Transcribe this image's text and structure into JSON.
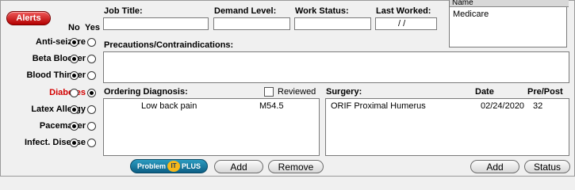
{
  "alerts": {
    "button_label": "Alerts",
    "col_no": "No",
    "col_yes": "Yes",
    "items": [
      {
        "label": "Anti-seizure",
        "selected": "No",
        "highlight": false
      },
      {
        "label": "Beta Blocker",
        "selected": "No",
        "highlight": false
      },
      {
        "label": "Blood Thinner",
        "selected": "No",
        "highlight": false
      },
      {
        "label": "Diabetes",
        "selected": "Yes",
        "highlight": true
      },
      {
        "label": "Latex Allergy",
        "selected": "No",
        "highlight": false
      },
      {
        "label": "Pacemaker",
        "selected": "No",
        "highlight": false
      },
      {
        "label": "Infect. Disease",
        "selected": "No",
        "highlight": false
      }
    ],
    "highlight_color": "#d40000"
  },
  "job": {
    "job_title_label": "Job Title:",
    "job_title_value": "",
    "demand_level_label": "Demand Level:",
    "demand_level_value": "",
    "work_status_label": "Work Status:",
    "work_status_value": "",
    "last_worked_label": "Last Worked:",
    "last_worked_value": "/ /"
  },
  "insurance": {
    "header": "Name",
    "items": [
      "Medicare"
    ]
  },
  "precautions": {
    "label": "Precautions/Contraindications:",
    "value": ""
  },
  "diagnosis": {
    "label": "Ordering Diagnosis:",
    "reviewed_label": "Reviewed",
    "reviewed_checked": false,
    "rows": [
      {
        "description": "Low back pain",
        "code": "M54.5"
      }
    ]
  },
  "surgery": {
    "label": "Surgery:",
    "date_label": "Date",
    "prepost_label": "Pre/Post",
    "rows": [
      {
        "name": "ORIF Proximal Humerus",
        "date": "02/24/2020",
        "prepost": "32"
      }
    ]
  },
  "buttons": {
    "problem_it_plus": "Problem",
    "problem_it_mid": "IT",
    "problem_it_suffix": "PLUS",
    "diag_add": "Add",
    "diag_remove": "Remove",
    "surg_add": "Add",
    "surg_status": "Status"
  },
  "colors": {
    "alerts_button": "#c00000",
    "problem_it_button": "#1577a0"
  }
}
